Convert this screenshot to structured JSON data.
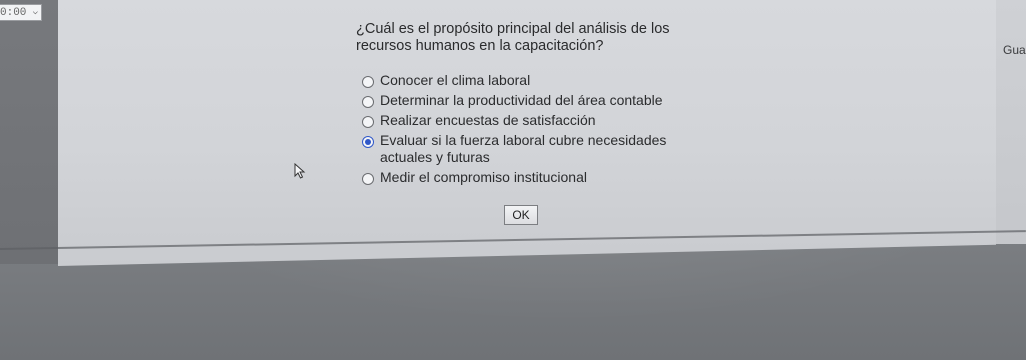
{
  "timer": {
    "value": "0:00",
    "dropdown_icon": "chevron-down-icon"
  },
  "quiz": {
    "question": "¿Cuál es el propósito principal del análisis de los recursos humanos en la capacitación?",
    "options": [
      {
        "label": "Conocer el clima laboral",
        "selected": false
      },
      {
        "label": "Determinar la productividad del área contable",
        "selected": false
      },
      {
        "label": "Realizar encuestas de satisfacción",
        "selected": false
      },
      {
        "label": "Evaluar si la fuerza laboral cubre necesidades actuales y futuras",
        "selected": true
      },
      {
        "label": "Medir el compromiso institucional",
        "selected": false
      }
    ],
    "ok_label": "OK"
  },
  "side_panel": {
    "label": "Gua"
  },
  "colors": {
    "radio_selected": "#2f57c8",
    "panel_background": "#d5d7db"
  }
}
